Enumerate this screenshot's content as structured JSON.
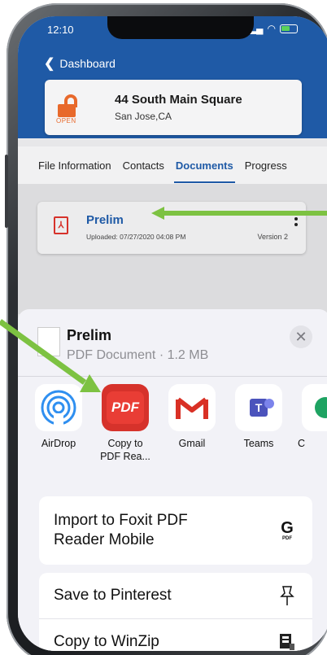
{
  "status": {
    "time": "12:10"
  },
  "nav": {
    "back_label": "Dashboard"
  },
  "property": {
    "title": "44 South Main Square",
    "location": "San Jose,CA",
    "lock_tag": "OPEN"
  },
  "tabs": [
    {
      "label": "File Information"
    },
    {
      "label": "Contacts"
    },
    {
      "label": "Documents",
      "active": true
    },
    {
      "label": "Progress"
    }
  ],
  "document": {
    "name": "Prelim",
    "uploaded": "Uploaded: 07/27/2020 04:08 PM",
    "version": "Version 2"
  },
  "share_sheet": {
    "title": "Prelim",
    "subtitle": "PDF Document · 1.2 MB",
    "apps": [
      {
        "label": "AirDrop",
        "icon": "airdrop-icon"
      },
      {
        "label": "Copy to PDF Rea...",
        "label_line1": "Copy to",
        "label_line2": "PDF Rea...",
        "icon": "pdf-reader-icon",
        "icon_text": "PDF"
      },
      {
        "label": "Gmail",
        "icon": "gmail-icon",
        "icon_text": "M"
      },
      {
        "label": "Teams",
        "icon": "teams-icon",
        "icon_text": "T"
      },
      {
        "label": "C",
        "icon": "chrome-icon"
      }
    ],
    "actions": [
      {
        "label": "Import to Foxit PDF Reader Mobile",
        "line1": "Import to Foxit PDF",
        "line2": "Reader Mobile",
        "icon": "foxit-icon",
        "icon_text": "G",
        "icon_sub": "PDF"
      },
      {
        "label": "Save to Pinterest",
        "icon": "pin-icon"
      },
      {
        "label": "Copy to WinZip",
        "icon": "winzip-icon"
      }
    ]
  },
  "colors": {
    "header_blue": "#1f5aa6",
    "lock_orange": "#e8692b",
    "pdf_red": "#d6322b",
    "arrow_green": "#7dc242"
  }
}
